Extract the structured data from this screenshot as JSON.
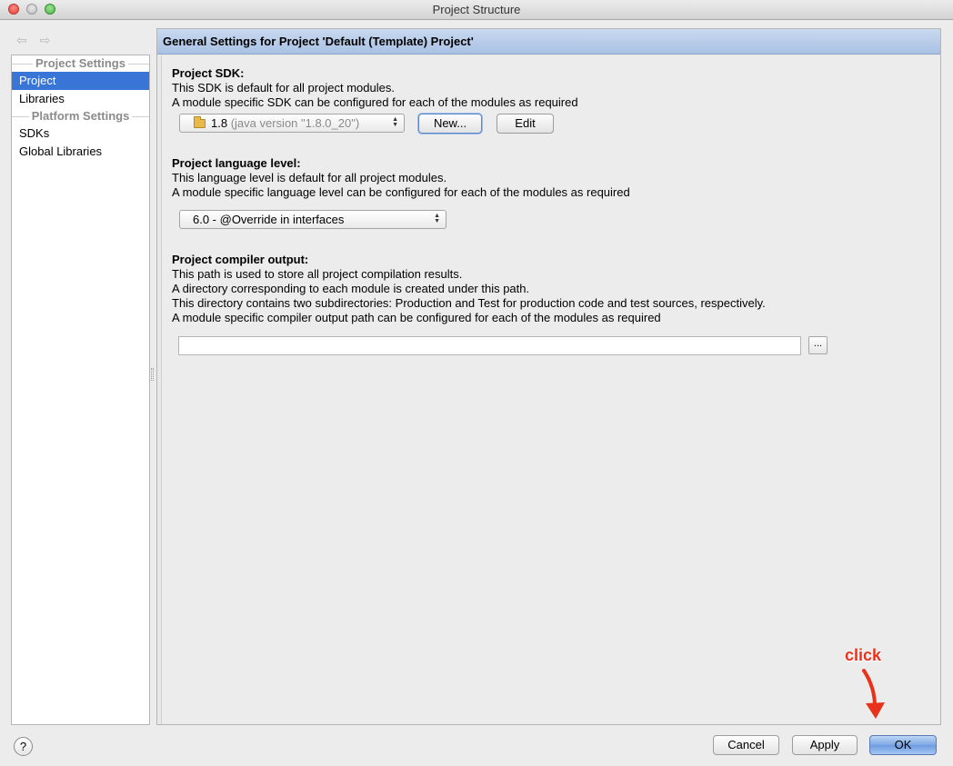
{
  "window": {
    "title": "Project Structure"
  },
  "nav": {
    "back": "⇦",
    "forward": "⇨"
  },
  "sidebar": {
    "project_settings_header": "Project Settings",
    "platform_settings_header": "Platform Settings",
    "items": [
      {
        "label": "Project",
        "selected": true
      },
      {
        "label": "Libraries",
        "selected": false
      },
      {
        "label": "SDKs",
        "selected": false
      },
      {
        "label": "Global Libraries",
        "selected": false
      }
    ]
  },
  "main": {
    "header": "General Settings for Project 'Default (Template) Project'",
    "sdk": {
      "title": "Project SDK:",
      "line1": "This SDK is default for all project modules.",
      "line2": "A module specific SDK can be configured for each of the modules as required",
      "selected_version": "1.8",
      "selected_detail": "(java version \"1.8.0_20\")",
      "new_button": "New...",
      "edit_button": "Edit"
    },
    "language": {
      "title": "Project language level:",
      "line1": "This language level is default for all project modules.",
      "line2": "A module specific language level can be configured for each of the modules as required",
      "selected": "6.0 - @Override in interfaces"
    },
    "compiler": {
      "title": "Project compiler output:",
      "line1": "This path is used to store all project compilation results.",
      "line2": "A directory corresponding to each module is created under this path.",
      "line3": "This directory contains two subdirectories: Production and Test for production code and test sources, respectively.",
      "line4": "A module specific compiler output path can be configured for each of the modules as required",
      "path_value": "",
      "browse_label": "..."
    }
  },
  "footer": {
    "help_label": "?",
    "cancel": "Cancel",
    "apply": "Apply",
    "ok": "OK"
  },
  "annotation": {
    "text": "click",
    "color": "#e8321c"
  },
  "colors": {
    "selection": "#3875d7",
    "header_blue": "#b8cdeb"
  }
}
